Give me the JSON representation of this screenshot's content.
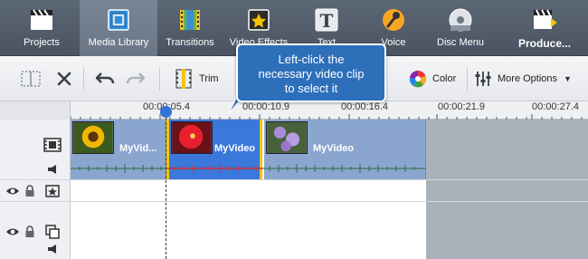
{
  "ribbon": {
    "tabs": [
      {
        "label": "Projects",
        "icon": "clapperboard-icon"
      },
      {
        "label": "Media Library",
        "icon": "film-frames-icon",
        "active": true
      },
      {
        "label": "Transitions",
        "icon": "film-strip-icon"
      },
      {
        "label": "Video Effects",
        "icon": "star-icon"
      },
      {
        "label": "Text",
        "icon": "letter-t-icon"
      },
      {
        "label": "Voice",
        "icon": "microphone-icon"
      },
      {
        "label": "Disc Menu",
        "icon": "disc-icon"
      },
      {
        "label": "Produce...",
        "icon": "produce-clapper-icon"
      }
    ]
  },
  "toolbar": {
    "trim_label": "Trim",
    "color_label": "Color",
    "more_options_label": "More Options"
  },
  "ruler": {
    "ticks": [
      "00:00:05.4",
      "00:00:10.9",
      "00:00:16.4",
      "00:00:21.9",
      "00:00:27.4"
    ]
  },
  "clips": [
    {
      "name": "MyVid...",
      "thumb": "sunflower"
    },
    {
      "name": "MyVideo",
      "thumb": "red-flower",
      "selected": true
    },
    {
      "name": "MyVideo",
      "thumb": "purple-flower"
    }
  ],
  "callout": {
    "text_line1": "Left-click the",
    "text_line2": "necessary video clip",
    "text_line3": "to select it"
  },
  "colors": {
    "ribbon_bg": "#4f5866",
    "clip_blue": "#8aa6cf",
    "clip_selected": "#3b78dc",
    "callout_bg": "#2e6fba",
    "selection_yellow": "#f5c400",
    "waveform": "#2f6b3a",
    "waveform_selected": "#c8323a"
  }
}
